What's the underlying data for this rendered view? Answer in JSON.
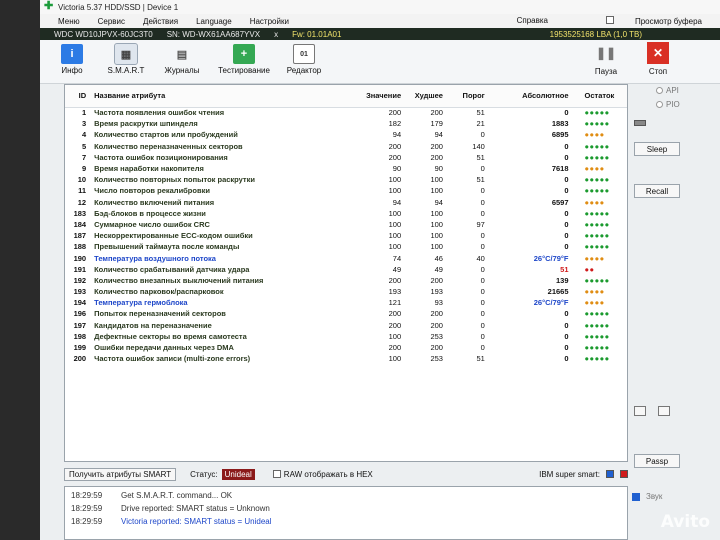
{
  "window": {
    "title": "Victoria 5.37 HDD/SSD | Device 1"
  },
  "menu": {
    "items": [
      "Меню",
      "Сервис",
      "Действия",
      "Language",
      "Настройки"
    ],
    "help": "Справка",
    "buffer_view": "Просмотр буфера"
  },
  "device": {
    "model": "WDC WD10JPVX-60JC3T0",
    "sn": "SN: WD-WX61AA687YVX",
    "x": "x",
    "fw": "Fw: 01.01A01",
    "lba": "1953525168 LBA (1,0 TB)"
  },
  "toolbar": {
    "info": "Инфо",
    "smart": "S.M.A.R.T",
    "logs": "Журналы",
    "test": "Тестирование",
    "editor": "Редактор",
    "pause": "Пауза",
    "stop": "Стоп"
  },
  "table": {
    "headers": {
      "id": "ID",
      "name": "Название атрибута",
      "value": "Значение",
      "worst": "Худшее",
      "threshold": "Порог",
      "absolute": "Абсолютное",
      "remain": "Остаток"
    },
    "rows": [
      {
        "id": "1",
        "name": "Частота появления ошибок чтения",
        "value": "200",
        "worst": "200",
        "thr": "51",
        "abs": "0",
        "dots": "●●●●●",
        "dc": "g",
        "ac": ""
      },
      {
        "id": "3",
        "name": "Время раскрутки шпинделя",
        "value": "182",
        "worst": "179",
        "thr": "21",
        "abs": "1883",
        "dots": "●●●●●",
        "dc": "g",
        "ac": ""
      },
      {
        "id": "4",
        "name": "Количество стартов или пробуждений",
        "value": "94",
        "worst": "94",
        "thr": "0",
        "abs": "6895",
        "dots": "●●●●",
        "dc": "o",
        "ac": ""
      },
      {
        "id": "5",
        "name": "Количество переназначенных секторов",
        "value": "200",
        "worst": "200",
        "thr": "140",
        "abs": "0",
        "dots": "●●●●●",
        "dc": "g",
        "ac": ""
      },
      {
        "id": "7",
        "name": "Частота ошибок позиционирования",
        "value": "200",
        "worst": "200",
        "thr": "51",
        "abs": "0",
        "dots": "●●●●●",
        "dc": "g",
        "ac": ""
      },
      {
        "id": "9",
        "name": "Время наработки накопителя",
        "value": "90",
        "worst": "90",
        "thr": "0",
        "abs": "7618",
        "dots": "●●●●",
        "dc": "o",
        "ac": ""
      },
      {
        "id": "10",
        "name": "Количество повторных попыток раскрутки",
        "value": "100",
        "worst": "100",
        "thr": "51",
        "abs": "0",
        "dots": "●●●●●",
        "dc": "g",
        "ac": ""
      },
      {
        "id": "11",
        "name": "Число повторов рекалибровки",
        "value": "100",
        "worst": "100",
        "thr": "0",
        "abs": "0",
        "dots": "●●●●●",
        "dc": "g",
        "ac": ""
      },
      {
        "id": "12",
        "name": "Количество включений питания",
        "value": "94",
        "worst": "94",
        "thr": "0",
        "abs": "6597",
        "dots": "●●●●",
        "dc": "o",
        "ac": ""
      },
      {
        "id": "183",
        "name": "Бэд-блоков в процессе жизни",
        "value": "100",
        "worst": "100",
        "thr": "0",
        "abs": "0",
        "dots": "●●●●●",
        "dc": "g",
        "ac": ""
      },
      {
        "id": "184",
        "name": "Суммарное число ошибок CRC",
        "value": "100",
        "worst": "100",
        "thr": "97",
        "abs": "0",
        "dots": "●●●●●",
        "dc": "g",
        "ac": ""
      },
      {
        "id": "187",
        "name": "Нескорректированные ECC-кодом ошибки",
        "value": "100",
        "worst": "100",
        "thr": "0",
        "abs": "0",
        "dots": "●●●●●",
        "dc": "g",
        "ac": ""
      },
      {
        "id": "188",
        "name": "Превышений таймаута после команды",
        "value": "100",
        "worst": "100",
        "thr": "0",
        "abs": "0",
        "dots": "●●●●●",
        "dc": "g",
        "ac": ""
      },
      {
        "id": "190",
        "name": "Температура воздушного потока",
        "value": "74",
        "worst": "46",
        "thr": "40",
        "abs": "26°C/79°F",
        "dots": "●●●●",
        "dc": "o",
        "ac": "blue",
        "nc": "blue"
      },
      {
        "id": "191",
        "name": "Количество срабатываний датчика удара",
        "value": "49",
        "worst": "49",
        "thr": "0",
        "abs": "51",
        "dots": "●●",
        "dc": "r",
        "ac": "red"
      },
      {
        "id": "192",
        "name": "Количество внезапных выключений питания",
        "value": "200",
        "worst": "200",
        "thr": "0",
        "abs": "139",
        "dots": "●●●●●",
        "dc": "g",
        "ac": ""
      },
      {
        "id": "193",
        "name": "Количество парковок/распарковок",
        "value": "193",
        "worst": "193",
        "thr": "0",
        "abs": "21665",
        "dots": "●●●●",
        "dc": "o",
        "ac": ""
      },
      {
        "id": "194",
        "name": "Температура гермоблока",
        "value": "121",
        "worst": "93",
        "thr": "0",
        "abs": "26°C/79°F",
        "dots": "●●●●",
        "dc": "o",
        "ac": "blue",
        "nc": "blue"
      },
      {
        "id": "196",
        "name": "Попыток переназначений секторов",
        "value": "200",
        "worst": "200",
        "thr": "0",
        "abs": "0",
        "dots": "●●●●●",
        "dc": "g",
        "ac": ""
      },
      {
        "id": "197",
        "name": "Кандидатов на переназначение",
        "value": "200",
        "worst": "200",
        "thr": "0",
        "abs": "0",
        "dots": "●●●●●",
        "dc": "g",
        "ac": ""
      },
      {
        "id": "198",
        "name": "Дефектные секторы во время самотеста",
        "value": "100",
        "worst": "253",
        "thr": "0",
        "abs": "0",
        "dots": "●●●●●",
        "dc": "g",
        "ac": ""
      },
      {
        "id": "199",
        "name": "Ошибки передачи данных через DMA",
        "value": "200",
        "worst": "200",
        "thr": "0",
        "abs": "0",
        "dots": "●●●●●",
        "dc": "g",
        "ac": ""
      },
      {
        "id": "200",
        "name": "Частота ошибок записи (multi-zone errors)",
        "value": "100",
        "worst": "253",
        "thr": "51",
        "abs": "0",
        "dots": "●●●●●",
        "dc": "g",
        "ac": ""
      }
    ]
  },
  "side": {
    "api": "API",
    "pio": "PIO",
    "sleep": "Sleep",
    "recall": "Recall",
    "passp": "Passp",
    "sound": "Звук"
  },
  "bottom": {
    "get_smart": "Получить атрибуты SMART",
    "status_label": "Статус:",
    "status_value": "Unideal",
    "raw_hex": "RAW отображать в HEX",
    "ibm": "IBM super smart:"
  },
  "log": [
    {
      "time": "18:29:59",
      "msg": "Get S.M.A.R.T. command... OK",
      "blue": false
    },
    {
      "time": "18:29:59",
      "msg": "Drive reported: SMART status = Unknown",
      "blue": false
    },
    {
      "time": "18:29:59",
      "msg": "Victoria reported: SMART status = Unideal",
      "blue": true
    }
  ],
  "watermark": "Avito",
  "colors": {
    "good": "#1b9a2e",
    "warn": "#e08d13",
    "bad": "#d01b1b",
    "temp": "#1e47c9"
  }
}
